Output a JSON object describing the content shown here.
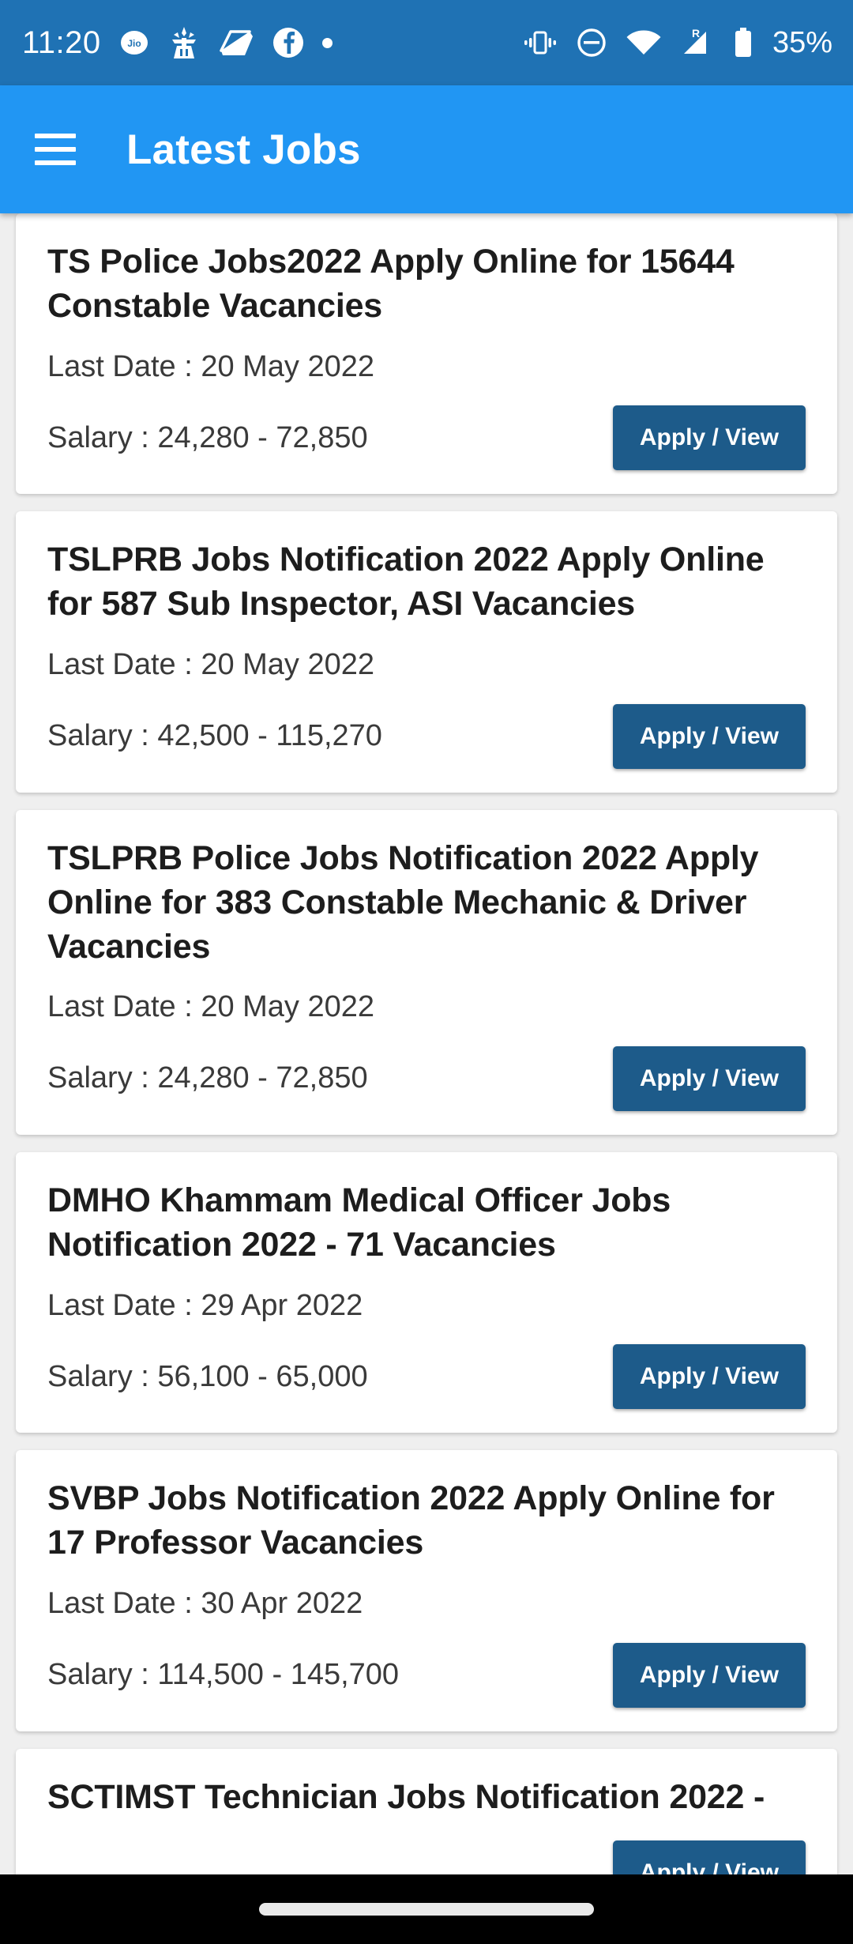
{
  "status_bar": {
    "time": "11:20",
    "left_icons": [
      "jio-icon",
      "deity-lamp-icon",
      "scanner-icon",
      "facebook-icon",
      "dot-icon"
    ],
    "right_icons": [
      "vibrate-icon",
      "do-not-disturb-icon",
      "wifi-icon",
      "signal-roaming-icon",
      "battery-icon"
    ],
    "roaming_label": "R",
    "battery_percent": "35%",
    "background_color": "#1f72b4"
  },
  "app_bar": {
    "menu_icon": "hamburger-menu-icon",
    "title": "Latest Jobs",
    "background_color": "#2196f3"
  },
  "labels": {
    "apply_button": "Apply / View"
  },
  "theme": {
    "page_background": "#efefef",
    "card_background": "#ffffff",
    "button_color": "#1d5b8a",
    "title_color": "#1d1d1d",
    "body_color": "#3a3a3a",
    "nav_background": "#000000"
  },
  "jobs": [
    {
      "title": "TS Police Jobs2022 Apply Online for 15644 Constable Vacancies",
      "last_date": "Last Date : 20 May 2022",
      "salary": "Salary : 24,280 - 72,850",
      "action": "Apply / View"
    },
    {
      "title": "TSLPRB Jobs Notification 2022 Apply Online for 587 Sub Inspector, ASI Vacancies",
      "last_date": "Last Date : 20 May 2022",
      "salary": "Salary : 42,500 - 115,270",
      "action": "Apply / View"
    },
    {
      "title": "TSLPRB Police Jobs Notification 2022 Apply Online for 383 Constable Mechanic & Driver Vacancies",
      "last_date": "Last Date : 20 May 2022",
      "salary": "Salary : 24,280 - 72,850",
      "action": "Apply / View"
    },
    {
      "title": "DMHO Khammam Medical Officer Jobs Notification 2022 - 71 Vacancies",
      "last_date": "Last Date : 29 Apr 2022",
      "salary": "Salary : 56,100 - 65,000",
      "action": "Apply / View"
    },
    {
      "title": "SVBP Jobs Notification 2022 Apply Online for 17 Professor Vacancies",
      "last_date": "Last Date : 30 Apr 2022",
      "salary": "Salary : 114,500 - 145,700",
      "action": "Apply / View"
    },
    {
      "title": "SCTIMST Technician Jobs Notification 2022 -",
      "last_date": "",
      "salary": "",
      "action": "Apply / View",
      "partial": true
    }
  ],
  "nav_bar": {
    "gesture_pill": "home-gesture-pill"
  }
}
